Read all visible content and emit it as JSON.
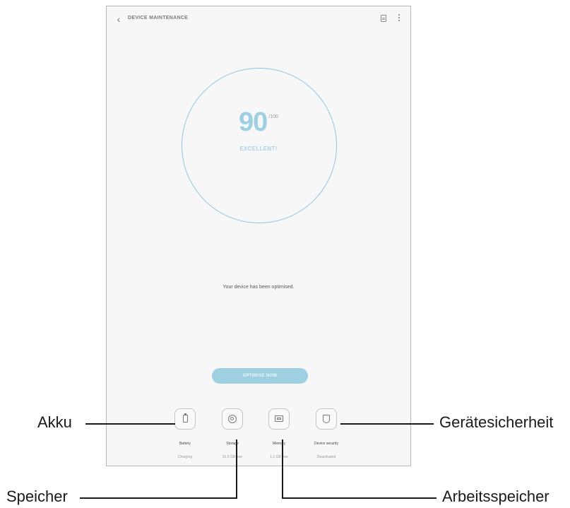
{
  "appbar": {
    "back_icon": "chevron-left-icon",
    "title": "DEVICE MAINTENANCE",
    "report_icon": "document-icon",
    "more_icon": "more-vertical-icon"
  },
  "score": {
    "value": "90",
    "max": "/100",
    "status": "EXCELLENT!"
  },
  "message": "Your device has been optimised.",
  "optimize_button": "OPTIMISE NOW",
  "categories": [
    {
      "label": "Battery",
      "value": "Charging",
      "icon": "battery-icon"
    },
    {
      "label": "Storage",
      "value": "31.5 GB free",
      "icon": "storage-icon"
    },
    {
      "label": "Memory",
      "value": "1.2 GB free",
      "icon": "memory-icon"
    },
    {
      "label": "Device security",
      "value": "Deactivated",
      "icon": "shield-icon"
    }
  ],
  "callouts": {
    "battery": "Akku",
    "storage": "Speicher",
    "memory": "Arbeitsspeicher",
    "security": "Gerätesicherheit"
  },
  "colors": {
    "accent": "#9fd0e2",
    "ring": "#8fc6de",
    "screen_bg": "#f7f7f7"
  }
}
